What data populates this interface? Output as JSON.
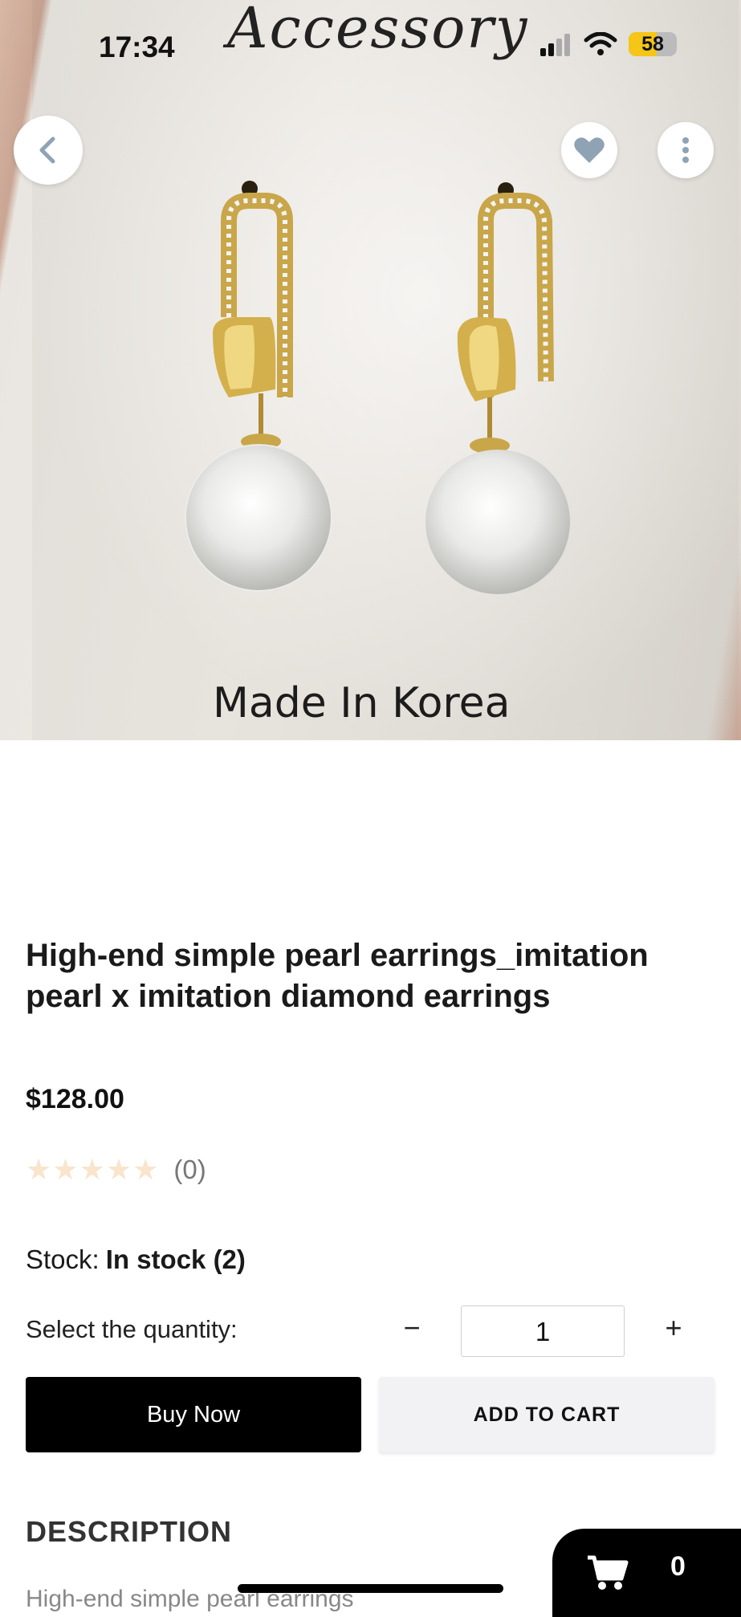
{
  "status_bar": {
    "time": "17:34",
    "battery_level": "58",
    "battery_fraction": 0.58
  },
  "hero_image": {
    "brand_text": "Accessory",
    "caption_text": "Made In Korea"
  },
  "nav": {
    "back_icon": "chevron-left-icon",
    "favorite_icon": "heart-icon",
    "more_icon": "more-vertical-icon"
  },
  "product": {
    "title": "High-end simple pearl earrings_imitation pearl x imitation diamond earrings",
    "price": "$128.00",
    "rating_value": 0,
    "rating_max": 5,
    "review_count": "(0)",
    "stock_label": "Stock:",
    "stock_value": "In stock (2)",
    "quantity_label": "Select the quantity:",
    "quantity": "1"
  },
  "actions": {
    "buy_now": "Buy Now",
    "add_to_cart": "ADD TO CART",
    "minus": "−",
    "plus": "+"
  },
  "description": {
    "heading": "DESCRIPTION",
    "preview": "High-end simple pearl earrings"
  },
  "cart": {
    "count": "0",
    "icon": "cart-icon"
  },
  "colors": {
    "primary_button": "#000000",
    "secondary_button": "#f2f2f4",
    "star_empty": "#fbe4cc",
    "heart_icon": "#8fa3b5",
    "battery_fill": "#f5c518"
  }
}
